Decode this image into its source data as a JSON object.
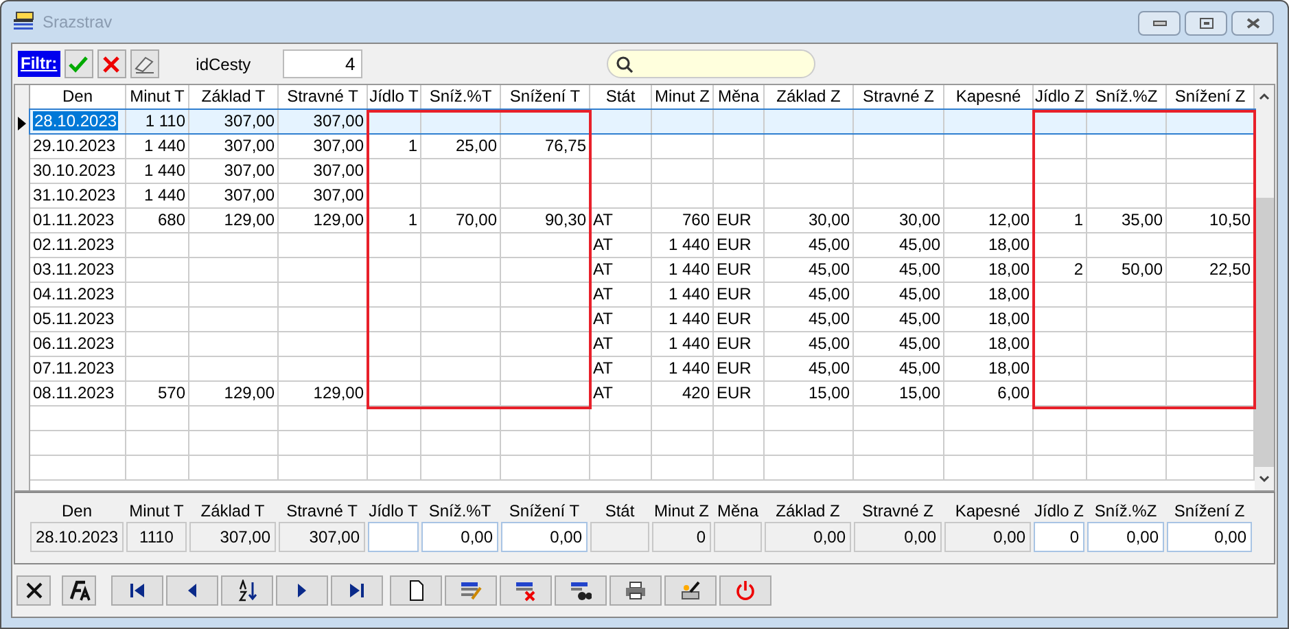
{
  "window": {
    "title": "Srazstrav"
  },
  "filter_bar": {
    "label": "Filtr:",
    "field_label": "idCesty",
    "field_value": "4"
  },
  "table": {
    "columns": [
      {
        "label": "Den",
        "highlighted": false
      },
      {
        "label": "Minut T",
        "highlighted": false
      },
      {
        "label": "Základ T",
        "highlighted": false
      },
      {
        "label": "Stravné T",
        "highlighted": false
      },
      {
        "label": "Jídlo T",
        "highlighted": true
      },
      {
        "label": "Sníž.%T",
        "highlighted": true
      },
      {
        "label": "Snížení T",
        "highlighted": true
      },
      {
        "label": "Stát",
        "highlighted": false
      },
      {
        "label": "Minut Z",
        "highlighted": false
      },
      {
        "label": "Měna",
        "highlighted": false
      },
      {
        "label": "Základ Z",
        "highlighted": false
      },
      {
        "label": "Stravné Z",
        "highlighted": false
      },
      {
        "label": "Kapesné",
        "highlighted": false
      },
      {
        "label": "Jídlo Z",
        "highlighted": true
      },
      {
        "label": "Sníž.%Z",
        "highlighted": true
      },
      {
        "label": "Snížení Z",
        "highlighted": true
      }
    ],
    "rows": [
      {
        "selected": true,
        "cells": [
          "28.10.2023",
          "1 110",
          "307,00",
          "307,00",
          null,
          null,
          null,
          null,
          null,
          null,
          null,
          null,
          null,
          null,
          null,
          null
        ]
      },
      {
        "selected": false,
        "cells": [
          "29.10.2023",
          "1 440",
          "307,00",
          "307,00",
          "1",
          "25,00",
          "76,75",
          null,
          null,
          null,
          null,
          null,
          null,
          null,
          null,
          null
        ]
      },
      {
        "selected": false,
        "cells": [
          "30.10.2023",
          "1 440",
          "307,00",
          "307,00",
          null,
          null,
          null,
          null,
          null,
          null,
          null,
          null,
          null,
          null,
          null,
          null
        ]
      },
      {
        "selected": false,
        "cells": [
          "31.10.2023",
          "1 440",
          "307,00",
          "307,00",
          null,
          null,
          null,
          null,
          null,
          null,
          null,
          null,
          null,
          null,
          null,
          null
        ]
      },
      {
        "selected": false,
        "cells": [
          "01.11.2023",
          "680",
          "129,00",
          "129,00",
          "1",
          "70,00",
          "90,30",
          "AT",
          "760",
          "EUR",
          "30,00",
          "30,00",
          "12,00",
          "1",
          "35,00",
          "10,50"
        ]
      },
      {
        "selected": false,
        "cells": [
          "02.11.2023",
          null,
          null,
          null,
          null,
          null,
          null,
          "AT",
          "1 440",
          "EUR",
          "45,00",
          "45,00",
          "18,00",
          null,
          null,
          null
        ]
      },
      {
        "selected": false,
        "cells": [
          "03.11.2023",
          null,
          null,
          null,
          null,
          null,
          null,
          "AT",
          "1 440",
          "EUR",
          "45,00",
          "45,00",
          "18,00",
          "2",
          "50,00",
          "22,50"
        ]
      },
      {
        "selected": false,
        "cells": [
          "04.11.2023",
          null,
          null,
          null,
          null,
          null,
          null,
          "AT",
          "1 440",
          "EUR",
          "45,00",
          "45,00",
          "18,00",
          null,
          null,
          null
        ]
      },
      {
        "selected": false,
        "cells": [
          "05.11.2023",
          null,
          null,
          null,
          null,
          null,
          null,
          "AT",
          "1 440",
          "EUR",
          "45,00",
          "45,00",
          "18,00",
          null,
          null,
          null
        ]
      },
      {
        "selected": false,
        "cells": [
          "06.11.2023",
          null,
          null,
          null,
          null,
          null,
          null,
          "AT",
          "1 440",
          "EUR",
          "45,00",
          "45,00",
          "18,00",
          null,
          null,
          null
        ]
      },
      {
        "selected": false,
        "cells": [
          "07.11.2023",
          null,
          null,
          null,
          null,
          null,
          null,
          "AT",
          "1 440",
          "EUR",
          "45,00",
          "45,00",
          "18,00",
          null,
          null,
          null
        ]
      },
      {
        "selected": false,
        "cells": [
          "08.11.2023",
          "570",
          "129,00",
          "129,00",
          null,
          null,
          null,
          "AT",
          "420",
          "EUR",
          "15,00",
          "15,00",
          "6,00",
          null,
          null,
          null
        ]
      }
    ]
  },
  "detail_fields": [
    {
      "label": "Den",
      "value": "28.10.2023",
      "editable": false
    },
    {
      "label": "Minut T",
      "value": "1110",
      "editable": false
    },
    {
      "label": "Základ T",
      "value": "307,00",
      "editable": false
    },
    {
      "label": "Stravné T",
      "value": "307,00",
      "editable": false
    },
    {
      "label": "Jídlo T",
      "editable": true
    },
    {
      "label": "Sníž.%T",
      "value": "0,00",
      "editable": true
    },
    {
      "label": "Snížení T",
      "value": "0,00",
      "editable": true
    },
    {
      "label": "Stát",
      "editable": false
    },
    {
      "label": "Minut Z",
      "value": "0",
      "editable": false
    },
    {
      "label": "Měna",
      "editable": false
    },
    {
      "label": "Základ Z",
      "value": "0,00",
      "editable": false
    },
    {
      "label": "Stravné Z",
      "value": "0,00",
      "editable": false
    },
    {
      "label": "Kapesné",
      "value": "0,00",
      "editable": false
    },
    {
      "label": "Jídlo Z",
      "value": "0",
      "editable": true
    },
    {
      "label": "Sníž.%Z",
      "value": "0,00",
      "editable": true
    },
    {
      "label": "Snížení Z",
      "value": "0,00",
      "editable": true
    }
  ],
  "toolbar": [
    {
      "kind": "close"
    },
    {
      "kind": "font"
    },
    {
      "kind": "first"
    },
    {
      "kind": "prev"
    },
    {
      "kind": "sort"
    },
    {
      "kind": "next"
    },
    {
      "kind": "last"
    },
    {
      "kind": "new"
    },
    {
      "kind": "edit"
    },
    {
      "kind": "delete"
    },
    {
      "kind": "find"
    },
    {
      "kind": "print"
    },
    {
      "kind": "print-setup"
    },
    {
      "kind": "power"
    }
  ]
}
